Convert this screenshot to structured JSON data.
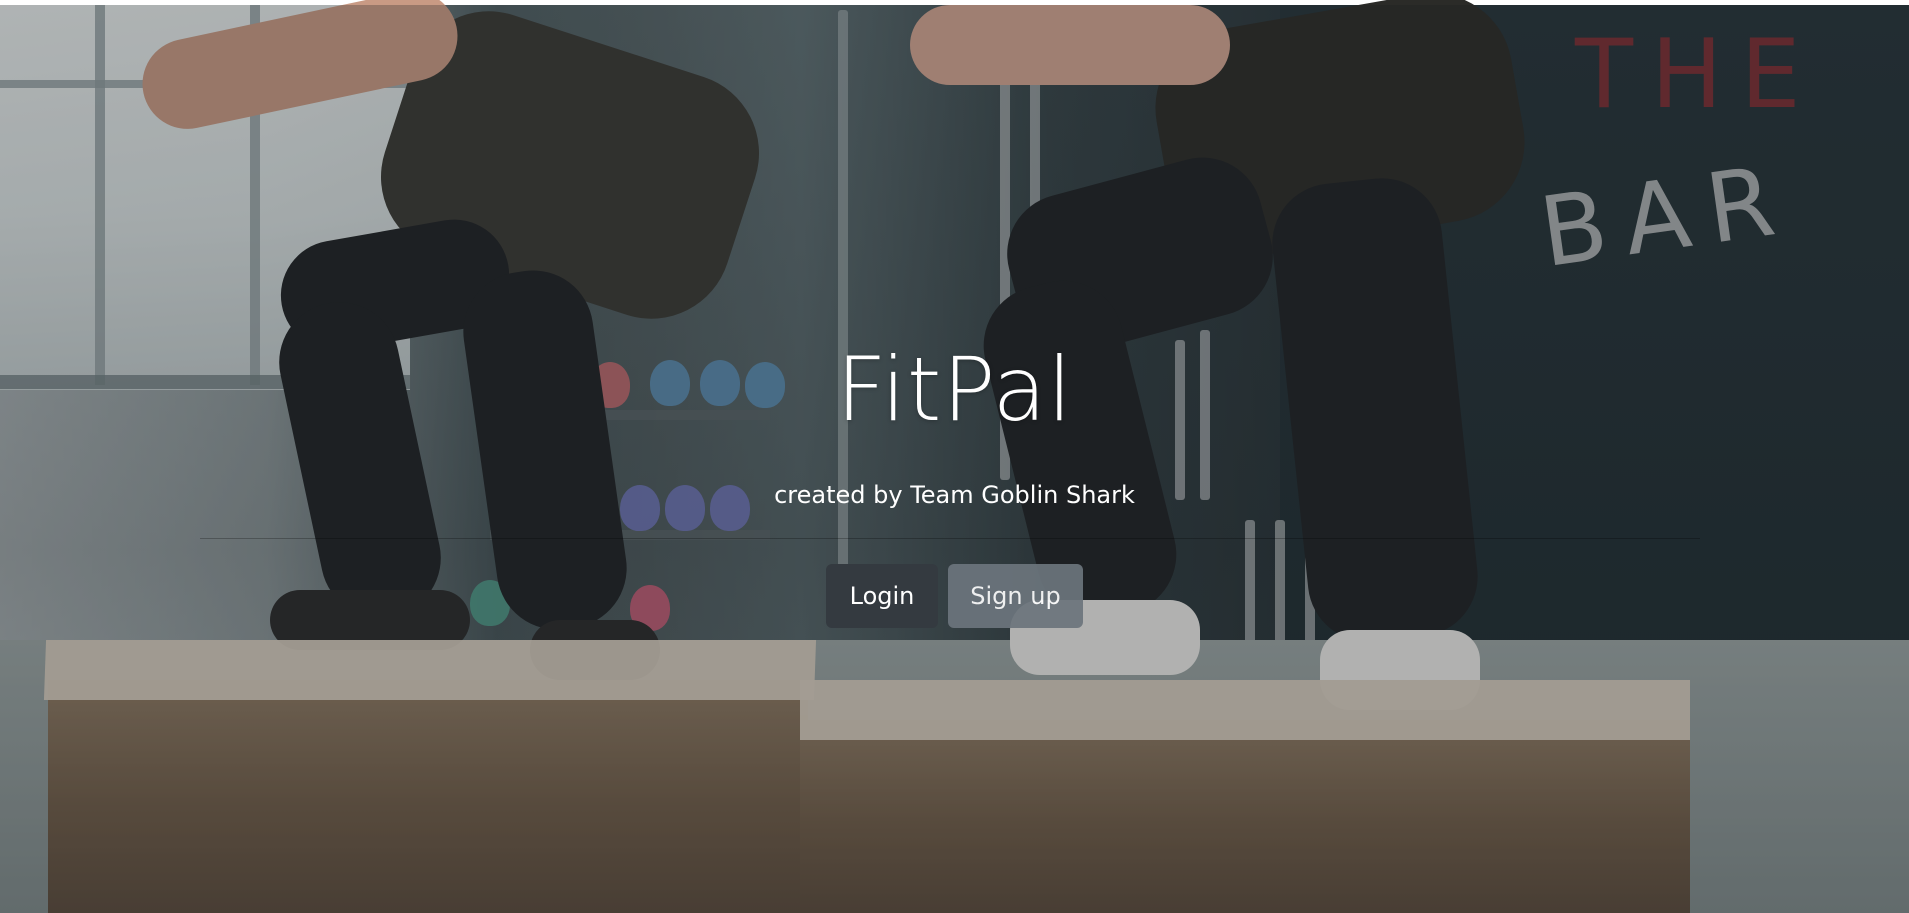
{
  "app": {
    "title": "FitPal",
    "subtitle": "created by Team Goblin Shark"
  },
  "actions": {
    "login_label": "Login",
    "signup_label": "Sign up"
  },
  "background": {
    "wall_text_top": "THE",
    "wall_text_bottom": "BAR"
  },
  "colors": {
    "login_button": "#343a40",
    "signup_button": "#6c757d",
    "text": "#ffffff"
  }
}
